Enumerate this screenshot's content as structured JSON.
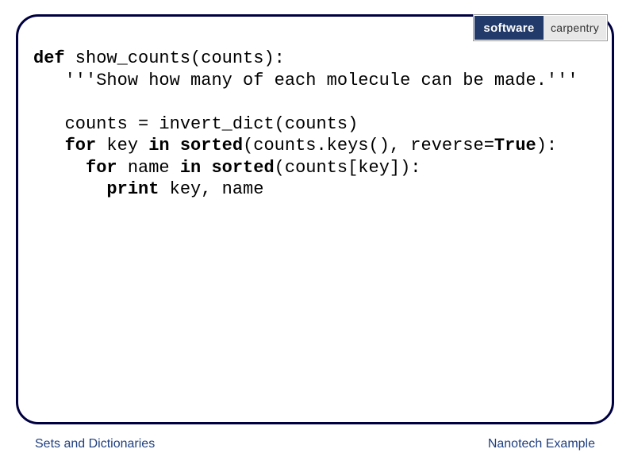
{
  "logo": {
    "left": "software",
    "right": "carpentry"
  },
  "code": {
    "line1_def": "def",
    "line1_rest": " show_counts(counts):",
    "line2": "'''Show how many of each molecule can be made.'''",
    "line4": "counts = invert_dict(counts)",
    "line5a": "for",
    "line5b": " key ",
    "line5c": "in",
    "line5d": " ",
    "line5e": "sorted",
    "line5f": "(counts.keys(), reverse=",
    "line5g": "True",
    "line5h": "):",
    "line6a": "for",
    "line6b": " name ",
    "line6c": "in",
    "line6d": " ",
    "line6e": "sorted",
    "line6f": "(counts[key]):",
    "line7a": "print",
    "line7b": " key, name"
  },
  "footer": {
    "left": "Sets and Dictionaries",
    "right": "Nanotech Example"
  }
}
